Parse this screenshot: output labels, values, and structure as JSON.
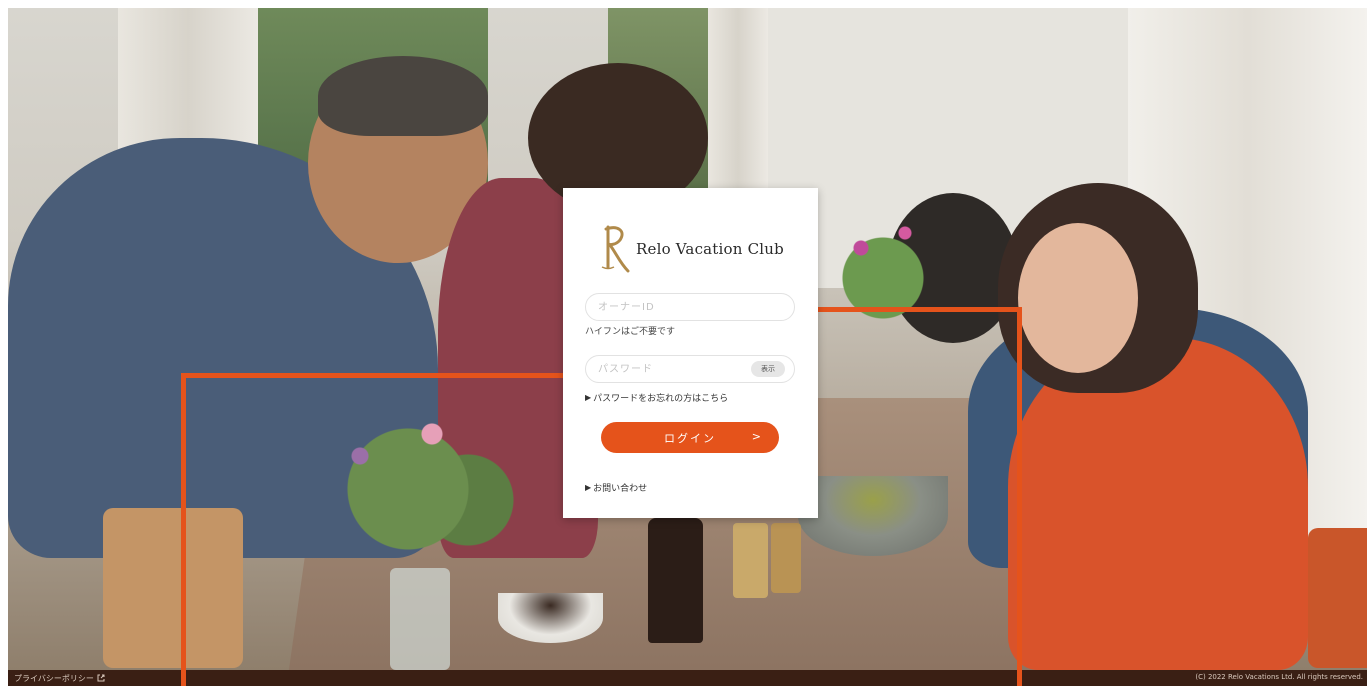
{
  "brand": {
    "name": "Relo Vacation Club"
  },
  "login": {
    "owner_id_placeholder": "オーナーID",
    "owner_id_hint": "ハイフンはご不要です",
    "password_placeholder": "パスワード",
    "show_label": "表示",
    "forgot_password": "パスワードをお忘れの方はこちら",
    "login_button": "ログイン",
    "login_chevron": ">",
    "contact": "お問い合わせ",
    "link_marker": "▶"
  },
  "footer": {
    "privacy_policy": "プライバシーポリシー",
    "external_icon": "external-link-icon",
    "copyright": "(C) 2022 Relo Vacations Ltd. All rights reserved."
  },
  "colors": {
    "accent": "#e5531b",
    "footer_bg": "#3a1f14",
    "logo_gold": "#b08a4a"
  }
}
